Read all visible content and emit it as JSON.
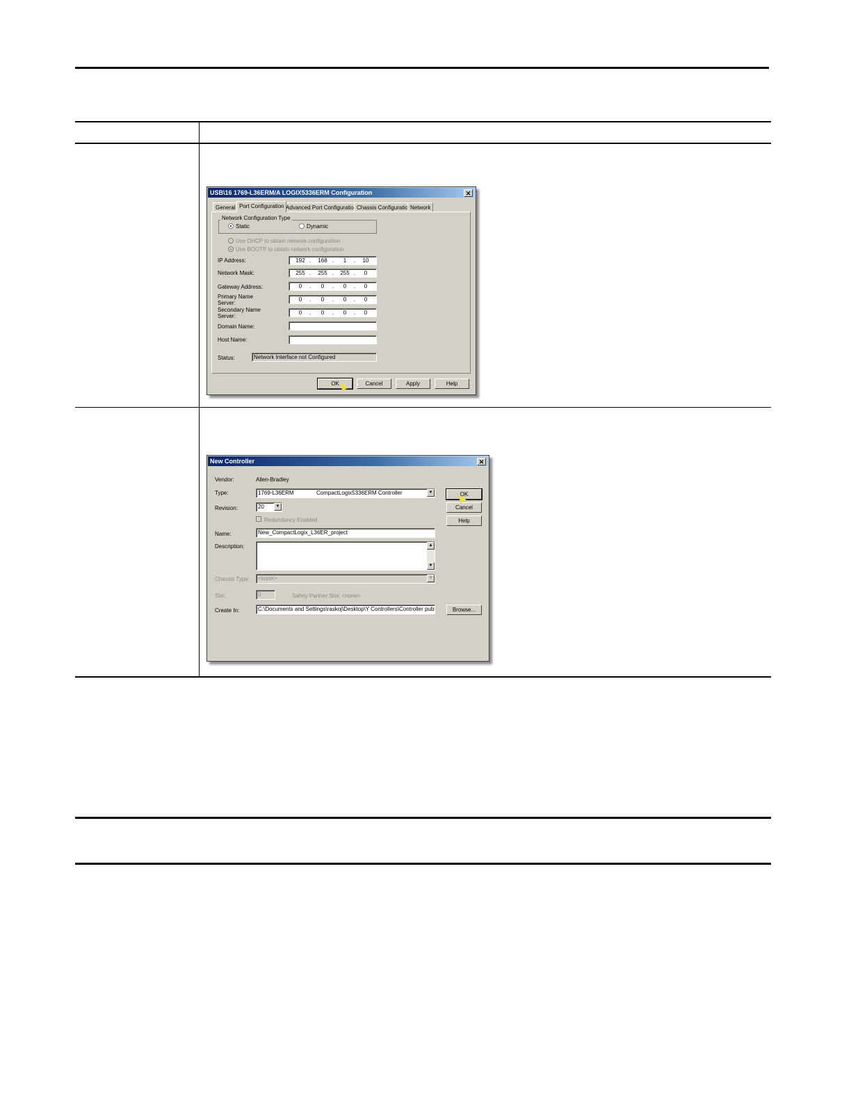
{
  "dialog1": {
    "title": "USB\\16 1769-L36ERM/A LOGIX5336ERM Configuration",
    "tabs": [
      "General",
      "Port Configuration",
      "Advanced Port Configuration",
      "Chassis Configuration",
      "Network"
    ],
    "group_label": "Network Configuration Type",
    "radio_static": "Static",
    "radio_dynamic": "Dynamic",
    "use_dhcp": "Use DHCP to obtain network configuration",
    "use_bootp": "Use BOOTP to obtain network configuration",
    "ip_label": "IP Address:",
    "ip": [
      "192",
      "168",
      "1",
      "10"
    ],
    "mask_label": "Network Mask:",
    "mask": [
      "255",
      "255",
      "255",
      "0"
    ],
    "gateway_label": "Gateway Address:",
    "gateway": [
      "0",
      "0",
      "0",
      "0"
    ],
    "primary_label_1": "Primary Name",
    "primary_label_2": "Server:",
    "primary": [
      "0",
      "0",
      "0",
      "0"
    ],
    "secondary_label_1": "Secondary Name",
    "secondary_label_2": "Server:",
    "secondary": [
      "0",
      "0",
      "0",
      "0"
    ],
    "domain_label": "Domain Name:",
    "domain_value": "",
    "host_label": "Host Name:",
    "host_value": "",
    "status_label": "Status:",
    "status_value": "Network Interface not Configured",
    "ok": "OK",
    "cancel": "Cancel",
    "apply": "Apply",
    "help": "Help"
  },
  "dialog2": {
    "title": "New Controller",
    "vendor_label": "Vendor:",
    "vendor_value": "Allen-Bradley",
    "type_label": "Type:",
    "type_code": "1769-L36ERM",
    "type_desc": "CompactLogix5336ERM Controller",
    "revision_label": "Revision:",
    "revision_value": "20",
    "redundancy": "Redundancy Enabled",
    "name_label": "Name:",
    "name_value": "New_CompactLogix_L36ER_project",
    "description_label": "Description:",
    "chassis_label": "Chassis Type:",
    "chassis_value": "<none>",
    "slot_label": "Slot:",
    "slot_value": "0",
    "safety_label": "Safety Partner Slot: <none>",
    "create_label": "Create In:",
    "create_value": "C:\\Documents and Settings\\raskoj\\Desktop\\Y Controllers\\Controller publicat",
    "ok": "OK",
    "cancel": "Cancel",
    "help": "Help",
    "browse": "Browse..."
  }
}
